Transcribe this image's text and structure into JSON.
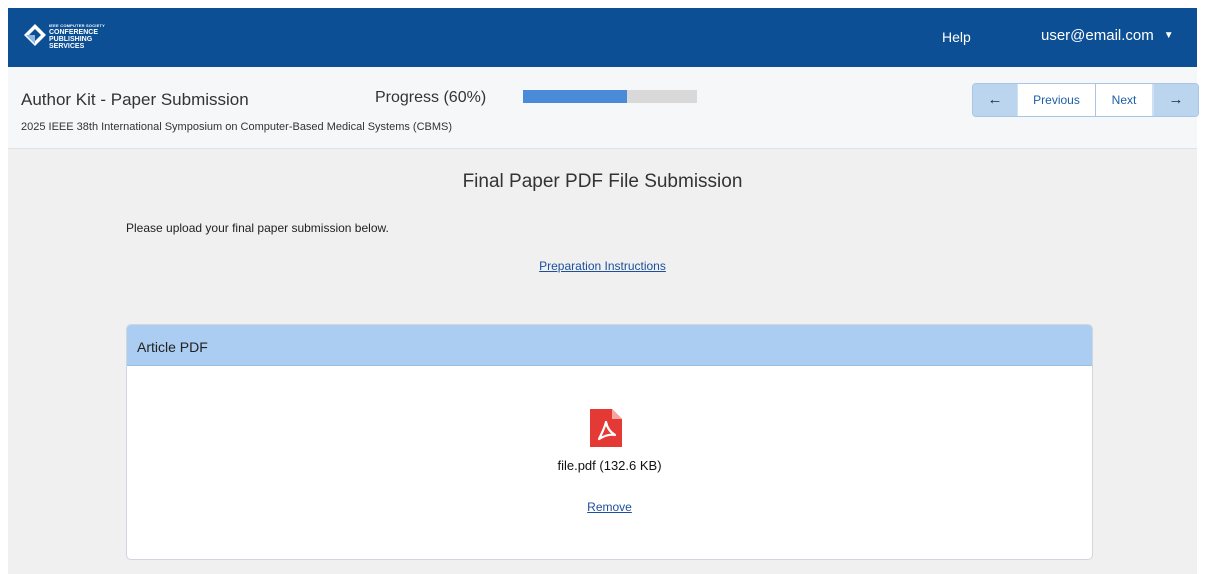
{
  "topbar": {
    "logo": {
      "small_text": "IEEE COMPUTER SOCIETY",
      "line1": "CONFERENCE",
      "line2": "PUBLISHING",
      "line3": "SERVICES"
    },
    "help_label": "Help",
    "user_email": "user@email.com",
    "menu_icon": "caret-down-icon"
  },
  "subheader": {
    "title": "Author Kit - Paper Submission",
    "conference": "2025 IEEE 38th International Symposium on Computer-Based Medical Systems (CBMS)",
    "progress_label": "Progress (60%)",
    "progress_value": 0.6,
    "nav": {
      "prev_icon": "arrow-left-icon",
      "prev_label": "Previous",
      "next_label": "Next",
      "next_icon": "arrow-right-icon"
    }
  },
  "main": {
    "heading": "Final Paper PDF File Submission",
    "intro": "Please upload your final paper submission below.",
    "prep_link": "Preparation Instructions",
    "card": {
      "title": "Article PDF",
      "file_icon": "pdf-file-icon",
      "file_label": "file.pdf (132.6 KB)",
      "remove_label": "Remove"
    }
  },
  "colors": {
    "topbar_bg": "#0d4f95",
    "progress_fill": "#4a8ad8",
    "card_header_bg": "#aacdf1",
    "pdf_red": "#e53935",
    "link": "#1c4f9c"
  }
}
